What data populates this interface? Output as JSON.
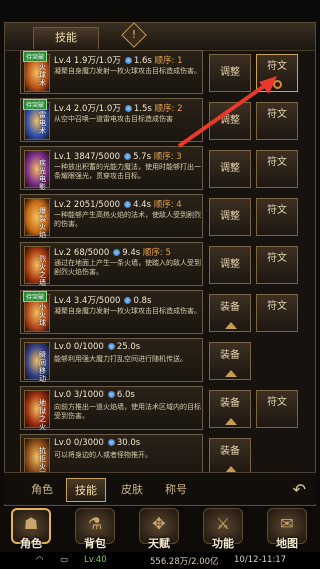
{
  "header": {
    "tab_label": "技能",
    "warning_icon": "!"
  },
  "skills": [
    {
      "name": "火球术",
      "tag": "待突破",
      "level": "Lv.4",
      "exp": "1.9万/1.0万",
      "cooldown": "1.6s",
      "order_label": "顺序:",
      "order": "1",
      "desc": "凝聚自身魔力发射一枚火球攻击目标造成伤害。",
      "icon_color": "#b8501a",
      "actions": [
        "调整",
        "符文"
      ]
    },
    {
      "name": "雷电术",
      "tag": "待突破",
      "level": "Lv.4",
      "exp": "2.0万/1.0万",
      "cooldown": "1.5s",
      "order_label": "顺序:",
      "order": "2",
      "desc": "从空中召唤一道雷电攻击目标造成伤害",
      "icon_color": "#2e4fb0",
      "actions": [
        "调整",
        "符文"
      ]
    },
    {
      "name": "疾光电影",
      "tag": "",
      "level": "Lv.1",
      "exp": "3847/5000",
      "cooldown": "5.7s",
      "order_label": "顺序:",
      "order": "3",
      "desc": "一种放出积蓄的光能力魔法，使用时能够打出一条耀眼强光，贯穿攻击目标。",
      "icon_color": "#7a2c8c",
      "actions": [
        "调整",
        "符文"
      ]
    },
    {
      "name": "爆裂火焰",
      "tag": "",
      "level": "Lv.2",
      "exp": "2051/5000",
      "cooldown": "4.4s",
      "order_label": "顺序:",
      "order": "4",
      "desc": "一种能够产生高热火焰的法术，使敌人受到剧烈的伤害。",
      "icon_color": "#c66a15",
      "actions": [
        "调整",
        "符文"
      ]
    },
    {
      "name": "烈火之墙",
      "tag": "",
      "level": "Lv.2",
      "exp": "68/5000",
      "cooldown": "9.4s",
      "order_label": "顺序:",
      "order": "5",
      "desc": "通过在地面上产生一条火墙，使踏入的敌人受到剧烈火焰伤害。",
      "icon_color": "#a8380f",
      "actions": [
        "调整",
        "符文"
      ]
    },
    {
      "name": "小火球",
      "tag": "待突破",
      "level": "Lv.4",
      "exp": "3.4万/5000",
      "cooldown": "0.8s",
      "order_label": "",
      "order": "",
      "desc": "凝聚自身魔力发射一枚火球攻击目标造成伤害。",
      "icon_color": "#b0461a",
      "actions": [
        "装备",
        "符文"
      ]
    },
    {
      "name": "瞬间移动",
      "tag": "",
      "level": "Lv.0",
      "exp": "0/1000",
      "cooldown": "25.0s",
      "order_label": "",
      "order": "",
      "desc": "能够利用强大魔力打乱空间进行随机传送。",
      "icon_color": "#30408a",
      "actions": [
        "装备"
      ]
    },
    {
      "name": "地狱之火",
      "tag": "",
      "level": "Lv.0",
      "exp": "3/1000",
      "cooldown": "6.0s",
      "order_label": "",
      "order": "",
      "desc": "向前方推出一道火焰墙，使用法术区域内的目标受到伤害。",
      "icon_color": "#9c2a10",
      "actions": [
        "装备",
        "符文"
      ]
    },
    {
      "name": "抗拒火环",
      "tag": "",
      "level": "Lv.0",
      "exp": "0/3000",
      "cooldown": "30.0s",
      "order_label": "",
      "order": "",
      "desc": "可以将身边的人或者怪物推开。",
      "icon_color": "#8a4a1a",
      "actions": [
        "装备"
      ]
    }
  ],
  "bottom_tabs": [
    "角色",
    "技能",
    "皮肤",
    "称号"
  ],
  "nav": [
    {
      "label": "角色",
      "icon": "hooded-figure-icon"
    },
    {
      "label": "背包",
      "icon": "bag-icon"
    },
    {
      "label": "天赋",
      "icon": "wings-icon"
    },
    {
      "label": "功能",
      "icon": "sword-icon"
    },
    {
      "label": "地图",
      "icon": "scroll-icon"
    }
  ],
  "status": {
    "level": "Lv.40",
    "network": "556.28万/2.00亿",
    "time": "10/12-11:17"
  },
  "colors": {
    "accent": "#c9a35a",
    "order": "#e6a34a",
    "arrow": "#e83a2a"
  }
}
